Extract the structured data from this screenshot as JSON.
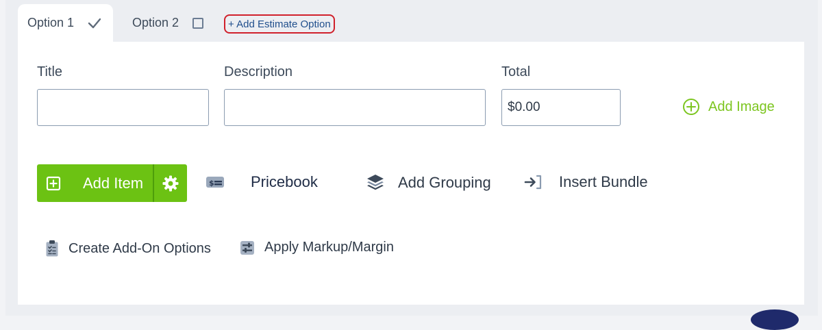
{
  "tabs": [
    {
      "label": "Option 1",
      "selected": true
    },
    {
      "label": "Option 2",
      "selected": false
    }
  ],
  "add_option_label": "+ Add Estimate Option",
  "form": {
    "title_label": "Title",
    "title_value": "",
    "description_label": "Description",
    "description_value": "",
    "total_label": "Total",
    "total_value": "$0.00"
  },
  "add_image_label": "Add Image",
  "actions": {
    "add_item_label": "Add Item",
    "pricebook_label": "Pricebook",
    "add_grouping_label": "Add Grouping",
    "insert_bundle_label": "Insert Bundle",
    "create_addon_label": "Create Add-On Options",
    "apply_markup_label": "Apply Markup/Margin"
  },
  "colors": {
    "accent_green": "#6cc213",
    "link_blue": "#1f4e8c",
    "highlight_red": "#d0202b"
  },
  "icons": {
    "tab1": "checkmark-icon",
    "tab2": "checkbox-icon",
    "add_image": "plus-circle-icon",
    "add_item": "plus-square-icon",
    "add_item_settings": "gear-icon",
    "pricebook": "price-tag-icon",
    "add_grouping": "layers-icon",
    "insert_bundle": "sign-in-arrow-icon",
    "create_addon": "clipboard-list-icon",
    "apply_markup": "sliders-icon"
  }
}
